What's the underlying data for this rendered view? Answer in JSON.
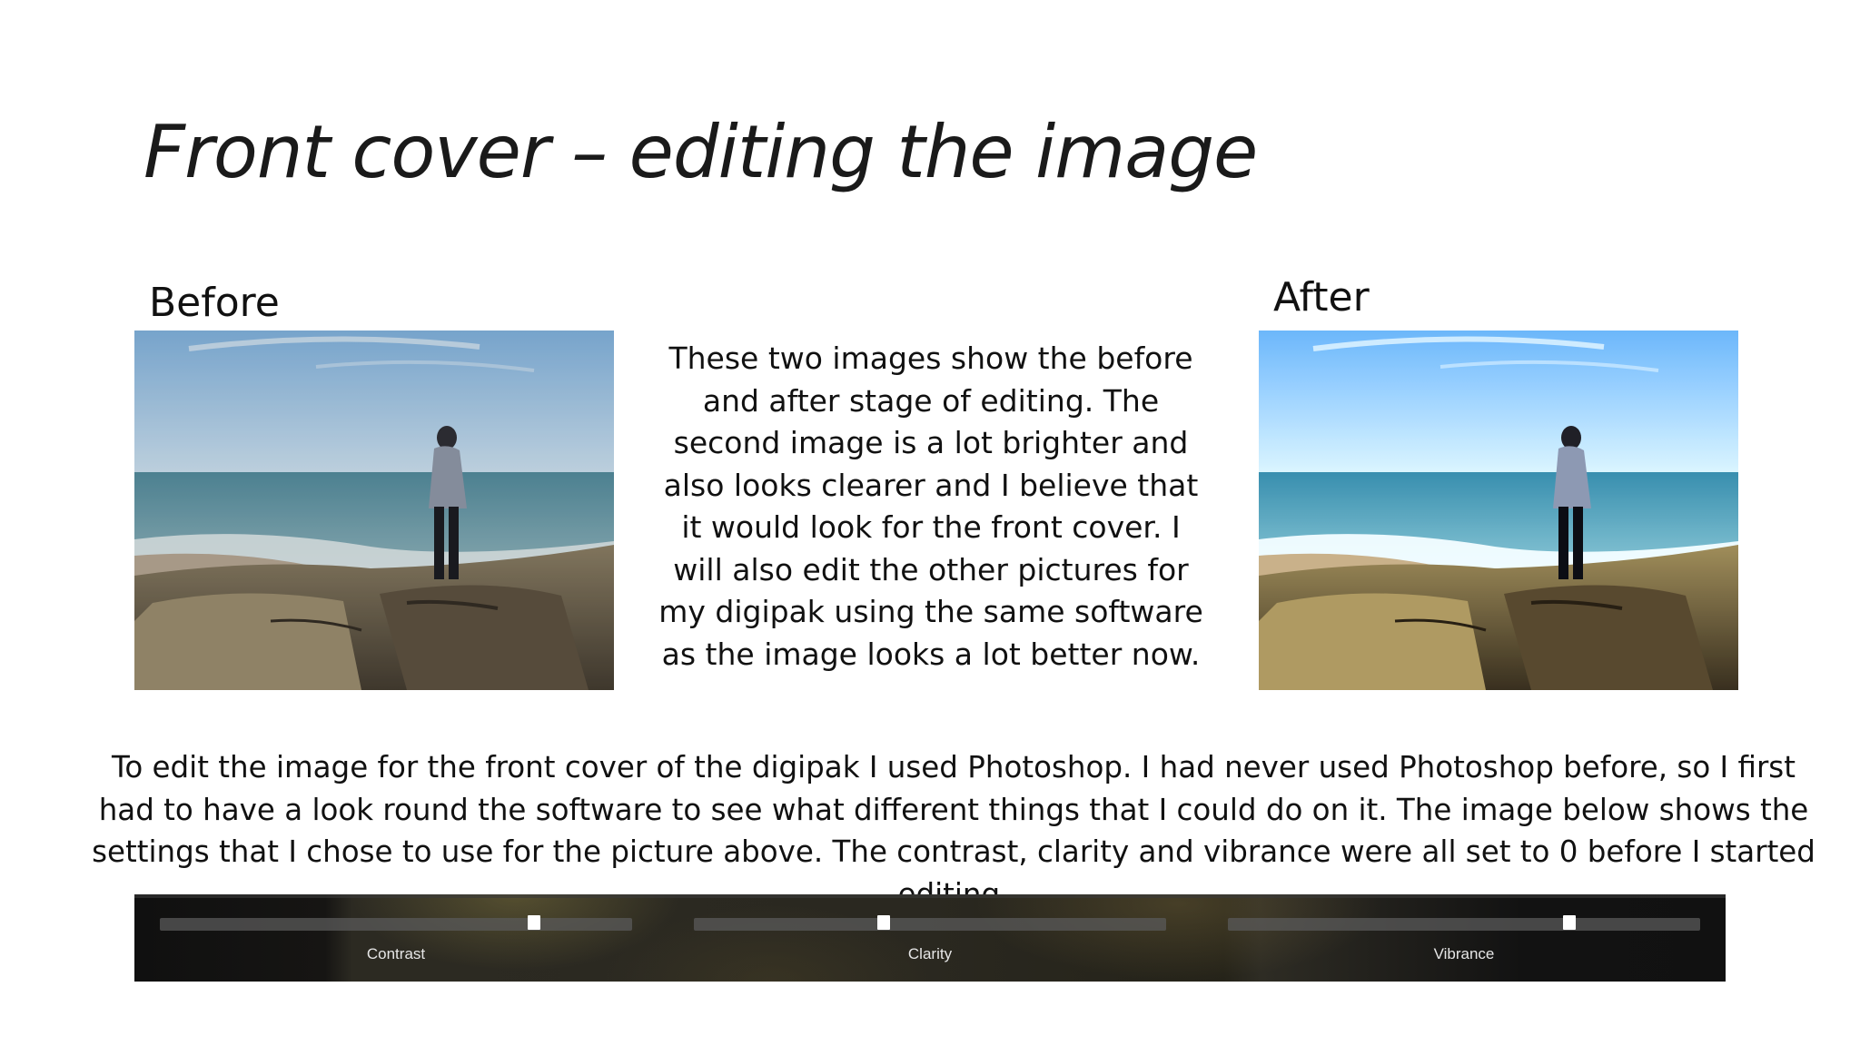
{
  "slide": {
    "title": "Front cover – editing the image",
    "before_label": "Before",
    "after_label": "After",
    "side_text": "These two images show the before and after stage of editing. The second image is a lot brighter and also looks clearer and I believe that it would look for the front cover. I will also edit the other pictures for my digipak using the same software as the image looks a lot better now.",
    "body_text": "To edit the image for the front cover of the digipak I used Photoshop. I had never used Photoshop before, so I first had to have a look round the software to see what different things that I could do on it. The image below shows the settings that I chose to use for the picture above. The contrast, clarity and vibrance were all set to 0 before I started editing."
  },
  "photos": {
    "before": {
      "icon": "beach-photo-before"
    },
    "after": {
      "icon": "beach-photo-after"
    }
  },
  "settings": {
    "sliders": [
      {
        "label": "Contrast",
        "fraction": 0.8
      },
      {
        "label": "Clarity",
        "fraction": 0.4
      },
      {
        "label": "Vibrance",
        "fraction": 0.73
      }
    ],
    "colors": {
      "panel": "#1b1a17",
      "track": "#5a5a5a",
      "knob": "#ffffff",
      "label": "#e6e6e6"
    }
  }
}
